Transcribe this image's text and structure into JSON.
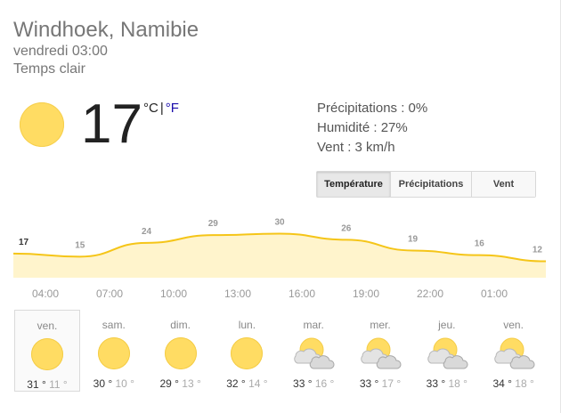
{
  "header": {
    "location": "Windhoek, Namibie",
    "datetime": "vendredi 03:00",
    "condition": "Temps clair"
  },
  "current": {
    "temperature": "17",
    "unit_c": "°C",
    "unit_sep": "|",
    "unit_f": "°F",
    "icon": "sun-icon"
  },
  "details": {
    "precipitation": "Précipitations : 0%",
    "humidity": "Humidité : 27%",
    "wind": "Vent : 3 km/h"
  },
  "tabs": [
    {
      "label": "Température",
      "active": true
    },
    {
      "label": "Précipitations",
      "active": false
    },
    {
      "label": "Vent",
      "active": false
    }
  ],
  "chart_data": {
    "type": "area",
    "x": [
      "04:00",
      "07:00",
      "10:00",
      "13:00",
      "16:00",
      "19:00",
      "22:00",
      "01:00"
    ],
    "series": [
      {
        "values": [
          17,
          15,
          24,
          29,
          30,
          26,
          19,
          16,
          12
        ]
      }
    ],
    "point_labels": [
      "17",
      "15",
      "24",
      "29",
      "30",
      "26",
      "19",
      "16",
      "12"
    ],
    "colors": {
      "line": "#f5c518",
      "fill": "#fff4cc"
    }
  },
  "hours": [
    "04:00",
    "07:00",
    "10:00",
    "13:00",
    "16:00",
    "19:00",
    "22:00",
    "01:00"
  ],
  "forecast": [
    {
      "day": "ven.",
      "icon": "sun-icon",
      "hi": "31",
      "lo": "11",
      "selected": true
    },
    {
      "day": "sam.",
      "icon": "sun-icon",
      "hi": "30",
      "lo": "10",
      "selected": false
    },
    {
      "day": "dim.",
      "icon": "sun-icon",
      "hi": "29",
      "lo": "13",
      "selected": false
    },
    {
      "day": "lun.",
      "icon": "sun-icon",
      "hi": "32",
      "lo": "14",
      "selected": false
    },
    {
      "day": "mar.",
      "icon": "partly-cloudy-icon",
      "hi": "33",
      "lo": "16",
      "selected": false
    },
    {
      "day": "mer.",
      "icon": "partly-cloudy-icon",
      "hi": "33",
      "lo": "17",
      "selected": false
    },
    {
      "day": "jeu.",
      "icon": "partly-cloudy-icon",
      "hi": "33",
      "lo": "18",
      "selected": false
    },
    {
      "day": "ven.",
      "icon": "partly-cloudy-icon",
      "hi": "34",
      "lo": "18",
      "selected": false
    }
  ],
  "degree_symbol": "°"
}
